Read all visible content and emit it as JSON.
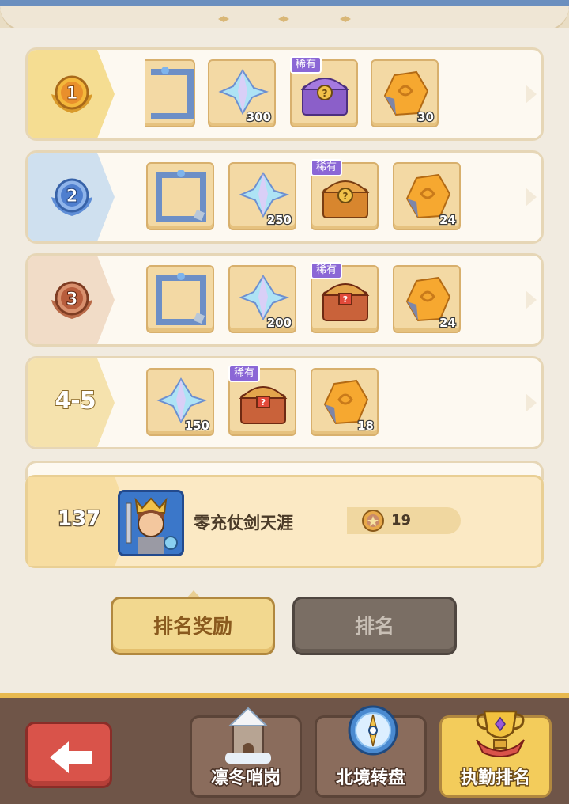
{
  "colors": {
    "accent_gold": "#f2d88f",
    "rare_tag": "#8b67d6",
    "back_button": "#d9534a",
    "bottom_bar": "#6f5548"
  },
  "reward_rows": [
    {
      "rank": "1",
      "tier": "gold",
      "rewards": [
        {
          "icon": "frame-icon",
          "qty": ""
        },
        {
          "icon": "crystal-icon",
          "qty": "300"
        },
        {
          "icon": "rare-chest-icon",
          "qty": "",
          "tag": "稀有"
        },
        {
          "icon": "amber-ore-icon",
          "qty": "30"
        }
      ]
    },
    {
      "rank": "2",
      "tier": "silver",
      "rewards": [
        {
          "icon": "frame-icon",
          "qty": ""
        },
        {
          "icon": "crystal-icon",
          "qty": "250"
        },
        {
          "icon": "chest-icon",
          "qty": "",
          "tag": "稀有"
        },
        {
          "icon": "amber-ore-icon",
          "qty": "24"
        }
      ]
    },
    {
      "rank": "3",
      "tier": "bronze",
      "rewards": [
        {
          "icon": "frame-icon",
          "qty": ""
        },
        {
          "icon": "crystal-icon",
          "qty": "200"
        },
        {
          "icon": "chest-icon",
          "qty": "",
          "tag": "稀有"
        },
        {
          "icon": "amber-ore-icon",
          "qty": "24"
        }
      ]
    },
    {
      "rank": "4-5",
      "tier": "plain",
      "rewards": [
        {
          "icon": "crystal-icon",
          "qty": "150"
        },
        {
          "icon": "chest-icon",
          "qty": "",
          "tag": "稀有"
        },
        {
          "icon": "amber-ore-icon",
          "qty": "18"
        }
      ]
    }
  ],
  "player": {
    "rank": "137",
    "name": "零充仗剑天涯",
    "score": "19",
    "avatar_icon": "king-avatar-icon",
    "score_icon": "medal-coin-icon"
  },
  "tabs": {
    "rank_rewards": "排名奖励",
    "ranking": "排名",
    "active": "rank_rewards"
  },
  "bottom_nav": {
    "back_icon": "back-arrow-icon",
    "items": [
      {
        "label": "凛冬哨岗",
        "icon": "tower-icon"
      },
      {
        "label": "北境转盘",
        "icon": "compass-wheel-icon"
      },
      {
        "label": "执勤排名",
        "icon": "trophy-icon",
        "active": true
      }
    ]
  }
}
